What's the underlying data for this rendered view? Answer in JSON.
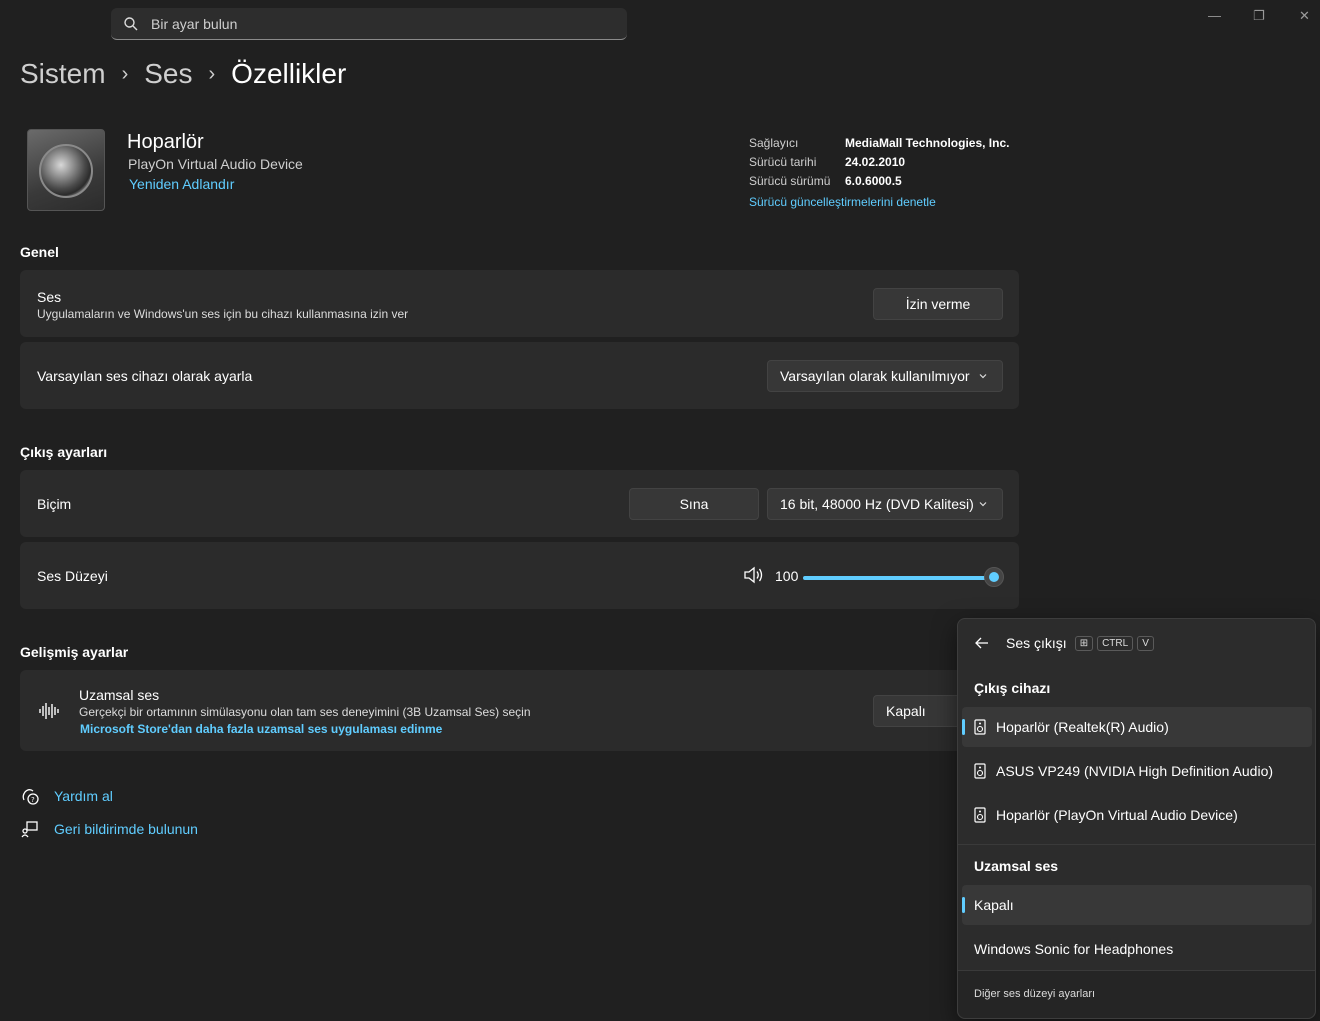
{
  "search": {
    "placeholder": "Bir ayar bulun"
  },
  "window_controls": {
    "minimize": "—",
    "maximize": "❐",
    "close": "✕"
  },
  "breadcrumb": {
    "item1": "Sistem",
    "item2": "Ses",
    "current": "Özellikler",
    "sep": "›"
  },
  "device": {
    "name": "Hoparlör",
    "subtitle": "PlayOn Virtual Audio Device",
    "rename_link": "Yeniden Adlandır"
  },
  "driver_info": {
    "provider_label": "Sağlayıcı",
    "provider_value": "MediaMall Technologies, Inc.",
    "date_label": "Sürücü tarihi",
    "date_value": "24.02.2010",
    "version_label": "Sürücü sürümü",
    "version_value": "6.0.6000.5",
    "update_link": "Sürücü güncelleştirmelerini denetle"
  },
  "general": {
    "heading": "Genel",
    "audio_title": "Ses",
    "audio_desc": "Uygulamaların ve Windows'un ses için bu cihazı kullanmasına izin ver",
    "audio_button": "İzin verme",
    "default_title": "Varsayılan ses cihazı olarak ayarla",
    "default_value": "Varsayılan olarak kullanılmıyor"
  },
  "output": {
    "heading": "Çıkış ayarları",
    "format_title": "Biçim",
    "test_button": "Sına",
    "format_value": "16 bit, 48000 Hz (DVD Kalitesi)",
    "volume_title": "Ses Düzeyi",
    "volume_value": "100",
    "volume_level": 100
  },
  "advanced": {
    "heading": "Gelişmiş ayarlar",
    "spatial_title": "Uzamsal ses",
    "spatial_desc": "Gerçekçi bir ortamının simülasyonu olan tam ses deneyimini (3B Uzamsal Ses) seçin",
    "spatial_link": "Microsoft Store'dan daha fazla uzamsal ses uygulaması edinme",
    "spatial_value": "Kapalı"
  },
  "footer": {
    "help": "Yardım al",
    "feedback": "Geri bildirimde bulunun"
  },
  "flyout": {
    "title": "Ses çıkışı",
    "kbd_win": "⊞",
    "kbd_ctrl": "CTRL",
    "kbd_v": "V",
    "devices_heading": "Çıkış cihazı",
    "devices": [
      "Hoparlör (Realtek(R) Audio)",
      "ASUS VP249 (NVIDIA High Definition Audio)",
      "Hoparlör (PlayOn Virtual Audio Device)"
    ],
    "spatial_heading": "Uzamsal ses",
    "spatial_options": [
      "Kapalı",
      "Windows Sonic for Headphones"
    ],
    "more_link": "Diğer ses düzeyi ayarları"
  },
  "colors": {
    "accent": "#60cdff",
    "background": "#202020",
    "card": "#2b2b2b"
  }
}
